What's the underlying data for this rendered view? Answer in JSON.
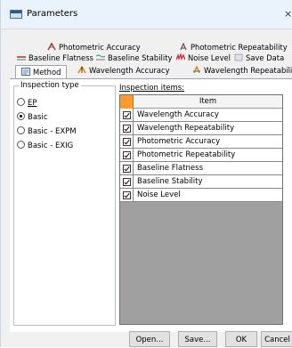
{
  "window": {
    "title": "Parameters",
    "close_glyph": "×"
  },
  "tabs": {
    "row1": [
      {
        "label": "Photometric Accuracy",
        "icon": "photometric-accuracy-icon"
      },
      {
        "label": "Photometric Repeatability",
        "icon": "photometric-repeatability-icon"
      }
    ],
    "row2": [
      {
        "label": "Baseline Flatness",
        "icon": "baseline-flatness-icon"
      },
      {
        "label": "Baseline Stability",
        "icon": "baseline-stability-icon"
      },
      {
        "label": "Noise Level",
        "icon": "noise-level-icon"
      },
      {
        "label": "Save Data",
        "icon": "save-data-icon"
      }
    ],
    "row3": [
      {
        "label": "Method",
        "icon": "method-icon",
        "selected": true
      },
      {
        "label": "Wavelength Accuracy",
        "icon": "wavelength-accuracy-icon"
      },
      {
        "label": "Wavelength Repeatability",
        "icon": "wavelength-repeatability-icon"
      }
    ]
  },
  "inspection_type": {
    "label": "Inspection type",
    "options": [
      {
        "label": "EP",
        "selected": false
      },
      {
        "label": "Basic",
        "selected": true
      },
      {
        "label": "Basic - EXPM",
        "selected": false
      },
      {
        "label": "Basic - EXIG",
        "selected": false
      }
    ]
  },
  "inspection_items": {
    "label": "Inspection items:",
    "column_header": "Item",
    "rows": [
      {
        "item": "Wavelength Accuracy",
        "checked": true
      },
      {
        "item": "Wavelength Repeatability",
        "checked": true
      },
      {
        "item": "Photometric Accuracy",
        "checked": true
      },
      {
        "item": "Photometric Repeatability",
        "checked": true
      },
      {
        "item": "Baseline Flatness",
        "checked": true
      },
      {
        "item": "Baseline Stability",
        "checked": true
      },
      {
        "item": "Noise Level",
        "checked": true
      }
    ]
  },
  "buttons": {
    "open": "Open...",
    "save": "Save...",
    "ok": "OK",
    "cancel": "Cancel"
  }
}
